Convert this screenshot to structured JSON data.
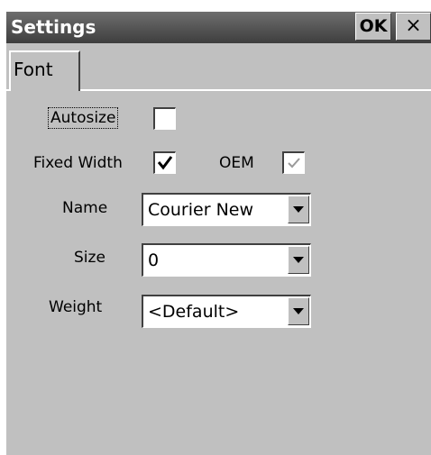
{
  "window": {
    "title": "Settings",
    "ok_label": "OK",
    "close_label": "×"
  },
  "tabs": [
    {
      "label": "Font",
      "active": true
    }
  ],
  "form": {
    "autosize": {
      "label": "Autosize",
      "checked": false
    },
    "fixed_width": {
      "label": "Fixed Width",
      "checked": true
    },
    "oem": {
      "label": "OEM",
      "checked": true,
      "enabled": false
    },
    "name": {
      "label": "Name",
      "value": "Courier New"
    },
    "size": {
      "label": "Size",
      "value": "0"
    },
    "weight": {
      "label": "Weight",
      "value": "<Default>"
    }
  }
}
